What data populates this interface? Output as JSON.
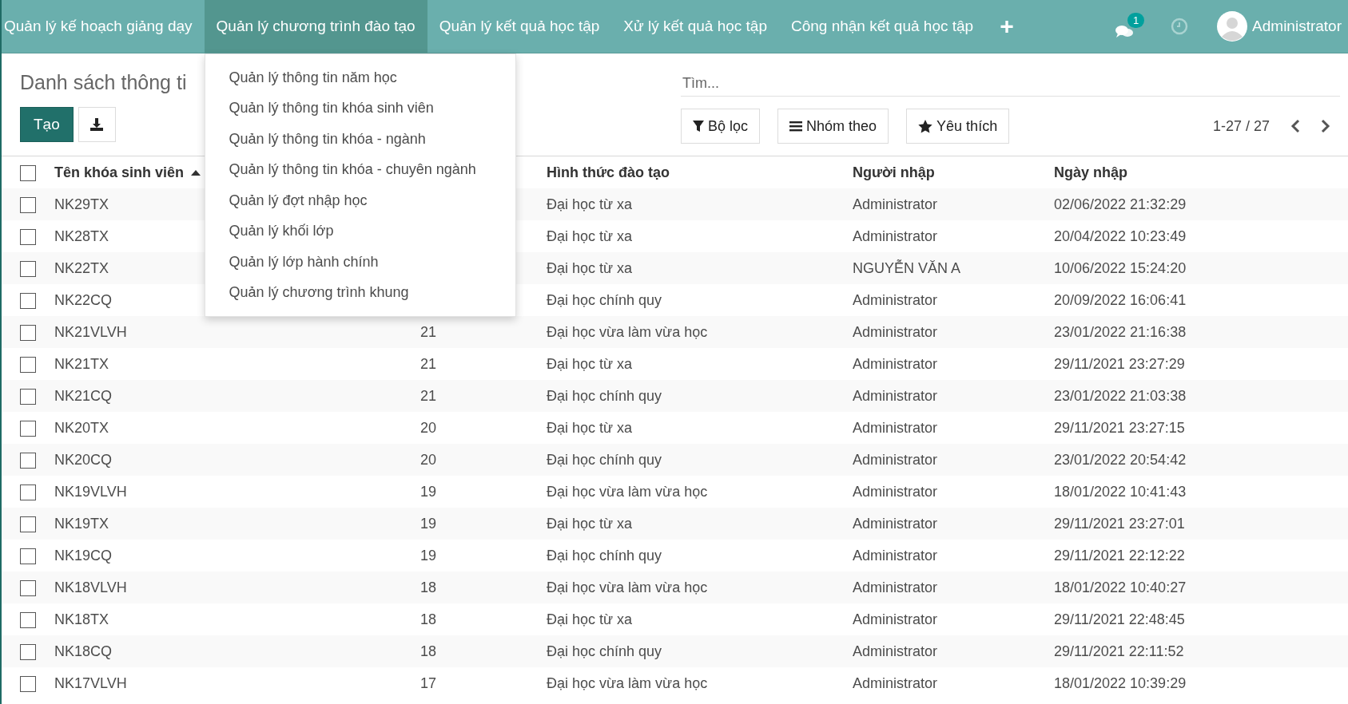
{
  "nav": {
    "items": [
      {
        "label": "Quản lý kế hoạch giảng dạy",
        "selected": false
      },
      {
        "label": "Quản lý chương trình đào tạo",
        "selected": true
      },
      {
        "label": "Quản lý kết quả học tập",
        "selected": false
      },
      {
        "label": "Xử lý kết quả học tập",
        "selected": false
      },
      {
        "label": "Công nhận kết quả học tập",
        "selected": false
      }
    ],
    "plus": "+",
    "chat_badge": "1",
    "user": "Administrator"
  },
  "dropdown": {
    "items": [
      "Quản lý thông tin năm học",
      "Quản lý thông tin khóa sinh viên",
      "Quản lý thông tin khóa - ngành",
      "Quản lý thông tin khóa - chuyên ngành",
      "Quản lý đợt nhập học",
      "Quản lý khối lớp",
      "Quản lý lớp hành chính",
      "Quản lý chương trình khung"
    ]
  },
  "control_panel": {
    "title": "Danh sách thông ti",
    "create_button": "Tạo",
    "search": {
      "placeholder": "Tìm..."
    },
    "filter_buttons": [
      {
        "label": "Bộ lọc",
        "kind": "filter"
      },
      {
        "label": "Nhóm theo",
        "kind": "group"
      },
      {
        "label": "Yêu thích",
        "kind": "favorite"
      }
    ],
    "pager": "1-27 / 27"
  },
  "table": {
    "select_all_checked": false,
    "columns": [
      {
        "label": "Tên khóa sinh viên",
        "sorted_ascending": true
      },
      {
        "label": "Hình thức đào tạo"
      },
      {
        "label": "Người nhập"
      },
      {
        "label": "Ngày nhập"
      }
    ],
    "rows": [
      {
        "checked": false,
        "name": "NK29TX",
        "form": "Đại học từ xa",
        "user": "Administrator",
        "date": "02/06/2022 21:32:29"
      },
      {
        "checked": false,
        "name": "NK28TX",
        "form": "Đại học từ xa",
        "user": "Administrator",
        "date": "20/04/2022 10:23:49"
      },
      {
        "checked": false,
        "name": "NK22TX",
        "form": "Đại học từ xa",
        "user": "NGUYỄN VĂN A",
        "date": "10/06/2022 15:24:20"
      },
      {
        "checked": false,
        "name": "NK22CQ",
        "form": "Đại học chính quy",
        "user": "Administrator",
        "date": "20/09/2022 16:06:41"
      },
      {
        "checked": false,
        "name": "NK21VLVH",
        "column_2": "21",
        "form": "Đại học vừa làm vừa học",
        "user": "Administrator",
        "date": "23/01/2022 21:16:38"
      },
      {
        "checked": false,
        "name": "NK21TX",
        "column_2": "21",
        "form": "Đại học từ xa",
        "user": "Administrator",
        "date": "29/11/2021 23:27:29"
      },
      {
        "checked": false,
        "name": "NK21CQ",
        "column_2": "21",
        "form": "Đại học chính quy",
        "user": "Administrator",
        "date": "23/01/2022 21:03:38"
      },
      {
        "checked": false,
        "name": "NK20TX",
        "column_2": "20",
        "form": "Đại học từ xa",
        "user": "Administrator",
        "date": "29/11/2021 23:27:15"
      },
      {
        "checked": false,
        "name": "NK20CQ",
        "column_2": "20",
        "form": "Đại học chính quy",
        "user": "Administrator",
        "date": "23/01/2022 20:54:42"
      },
      {
        "checked": false,
        "name": "NK19VLVH",
        "column_2": "19",
        "form": "Đại học vừa làm vừa học",
        "user": "Administrator",
        "date": "18/01/2022 10:41:43"
      },
      {
        "checked": false,
        "name": "NK19TX",
        "column_2": "19",
        "form": "Đại học từ xa",
        "user": "Administrator",
        "date": "29/11/2021 23:27:01"
      },
      {
        "checked": false,
        "name": "NK19CQ",
        "column_2": "19",
        "form": "Đại học chính quy",
        "user": "Administrator",
        "date": "29/11/2021 22:12:22"
      },
      {
        "checked": false,
        "name": "NK18VLVH",
        "column_2": "18",
        "form": "Đại học vừa làm vừa học",
        "user": "Administrator",
        "date": "18/01/2022 10:40:27"
      },
      {
        "checked": false,
        "name": "NK18TX",
        "column_2": "18",
        "form": "Đại học từ xa",
        "user": "Administrator",
        "date": "29/11/2021 22:48:45"
      },
      {
        "checked": false,
        "name": "NK18CQ",
        "column_2": "18",
        "form": "Đại học chính quy",
        "user": "Administrator",
        "date": "29/11/2021 22:11:52"
      },
      {
        "checked": false,
        "name": "NK17VLVH",
        "column_2": "17",
        "form": "Đại học vừa làm vừa học",
        "user": "Administrator",
        "date": "18/01/2022 10:39:29"
      }
    ]
  }
}
